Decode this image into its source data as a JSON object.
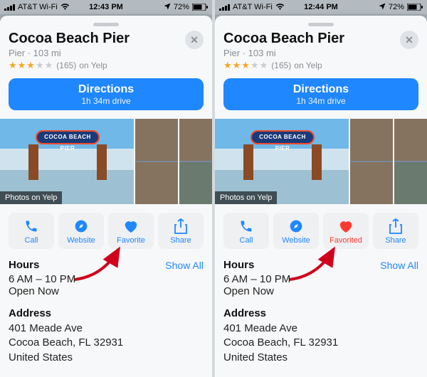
{
  "screens": [
    {
      "statusbar": {
        "carrier": "AT&T Wi-Fi",
        "time": "12:43 PM",
        "battery": "72%"
      },
      "favorite_state": "unfavorited"
    },
    {
      "statusbar": {
        "carrier": "AT&T Wi-Fi",
        "time": "12:44 PM",
        "battery": "72%"
      },
      "favorite_state": "favorited"
    }
  ],
  "place": {
    "name": "Cocoa Beach Pier",
    "category": "Pier",
    "distance": "103 mi",
    "subline": "Pier · 103 mi",
    "rating_stars": 3,
    "rating_of": 5,
    "review_count": "(165)",
    "review_source_text": "on Yelp",
    "sign_text": "COCOA BEACH PIER",
    "photos_badge": "Photos on Yelp"
  },
  "directions": {
    "title": "Directions",
    "subtitle": "1h 34m drive"
  },
  "actions": {
    "call": "Call",
    "website": "Website",
    "favorite": "Favorite",
    "favorited": "Favorited",
    "share": "Share"
  },
  "hours": {
    "label": "Hours",
    "show_all": "Show All",
    "range": "6 AM – 10 PM",
    "status": "Open Now"
  },
  "address": {
    "label": "Address",
    "line1": "401 Meade Ave",
    "line2": "Cocoa Beach, FL  32931",
    "line3": "United States"
  },
  "colors": {
    "accent": "#1f87ff",
    "favorited": "#ff3b30",
    "star": "#f5a623"
  }
}
